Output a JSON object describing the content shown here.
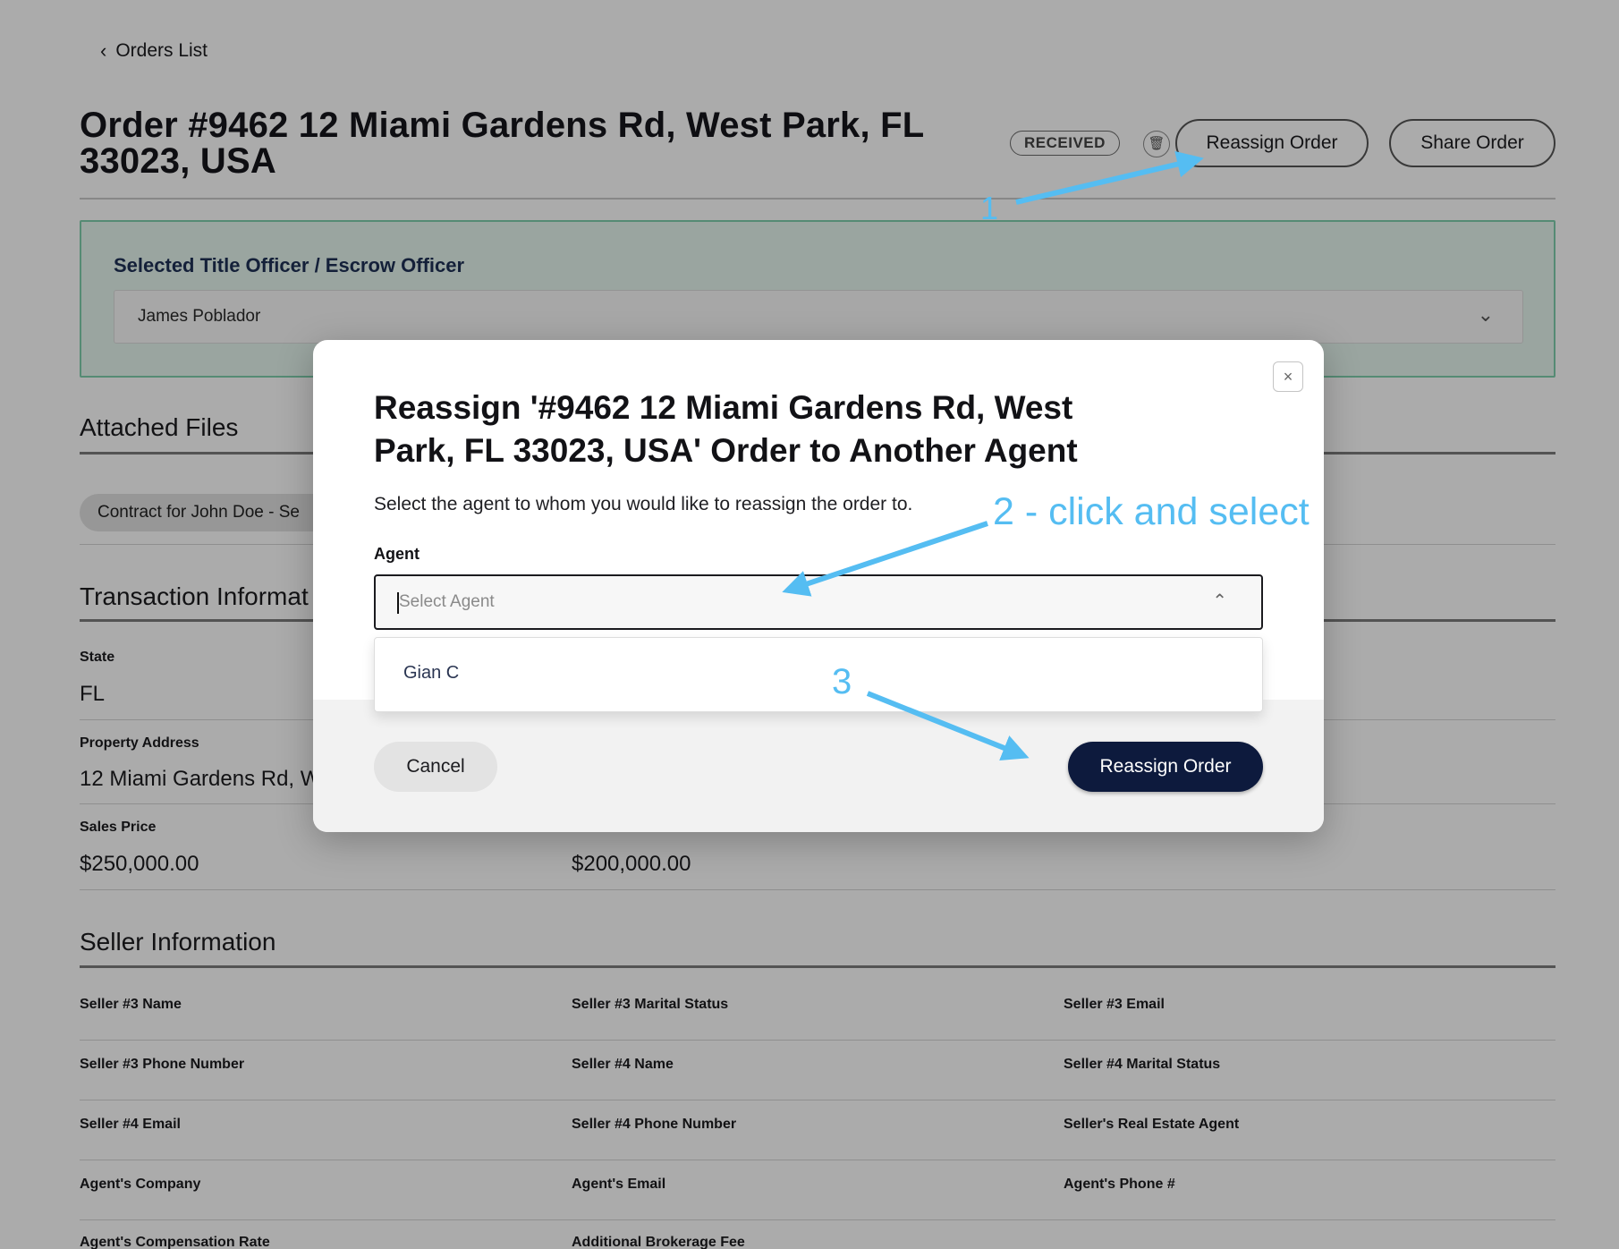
{
  "header": {
    "back_label": "Orders List",
    "order_title": "Order #9462 12 Miami Gardens Rd, West Park, FL 33023, USA",
    "status_badge": "RECEIVED",
    "reassign_label": "Reassign Order",
    "share_label": "Share Order"
  },
  "officer": {
    "label": "Selected Title Officer / Escrow Officer",
    "value": "James Poblador"
  },
  "attached_files": {
    "title": "Attached Files",
    "chip": "Contract for John Doe - Se"
  },
  "transaction": {
    "title": "Transaction Informat",
    "state_label": "State",
    "state_value": "FL",
    "address_label": "Property Address",
    "address_value": "12 Miami Gardens Rd, We",
    "sales_label": "Sales Price",
    "sales_value": "$250,000.00",
    "loan_value": "$200,000.00"
  },
  "seller": {
    "title": "Seller Information",
    "fields": [
      "Seller #3 Name",
      "Seller #3 Marital Status",
      "Seller #3 Email",
      "Seller #3 Phone Number",
      "Seller #4 Name",
      "Seller #4 Marital Status",
      "Seller #4 Email",
      "Seller #4 Phone Number",
      "Seller's Real Estate Agent",
      "Agent's Company",
      "Agent's Email",
      "Agent's Phone #",
      "Agent's Compensation Rate",
      "Additional Brokerage Fee"
    ]
  },
  "modal": {
    "close_icon": "×",
    "title": "Reassign '#9462 12 Miami Gardens Rd, West Park, FL 33023, USA' Order to Another Agent",
    "description": "Select the agent to whom you would like to reassign the order to.",
    "agent_label": "Agent",
    "agent_placeholder": "Select Agent",
    "options": [
      "Gian C"
    ],
    "cancel_label": "Cancel",
    "submit_label": "Reassign Order"
  },
  "annotations": {
    "step1": "1",
    "step2": "2 - click and select",
    "step3": "3",
    "color": "#55bdf2"
  },
  "icons": {
    "back": "chevron-left-icon",
    "trash": "trash-icon",
    "officer_chevron": "chevron-down-icon",
    "agent_chevron": "chevron-up-icon",
    "close": "close-icon"
  }
}
